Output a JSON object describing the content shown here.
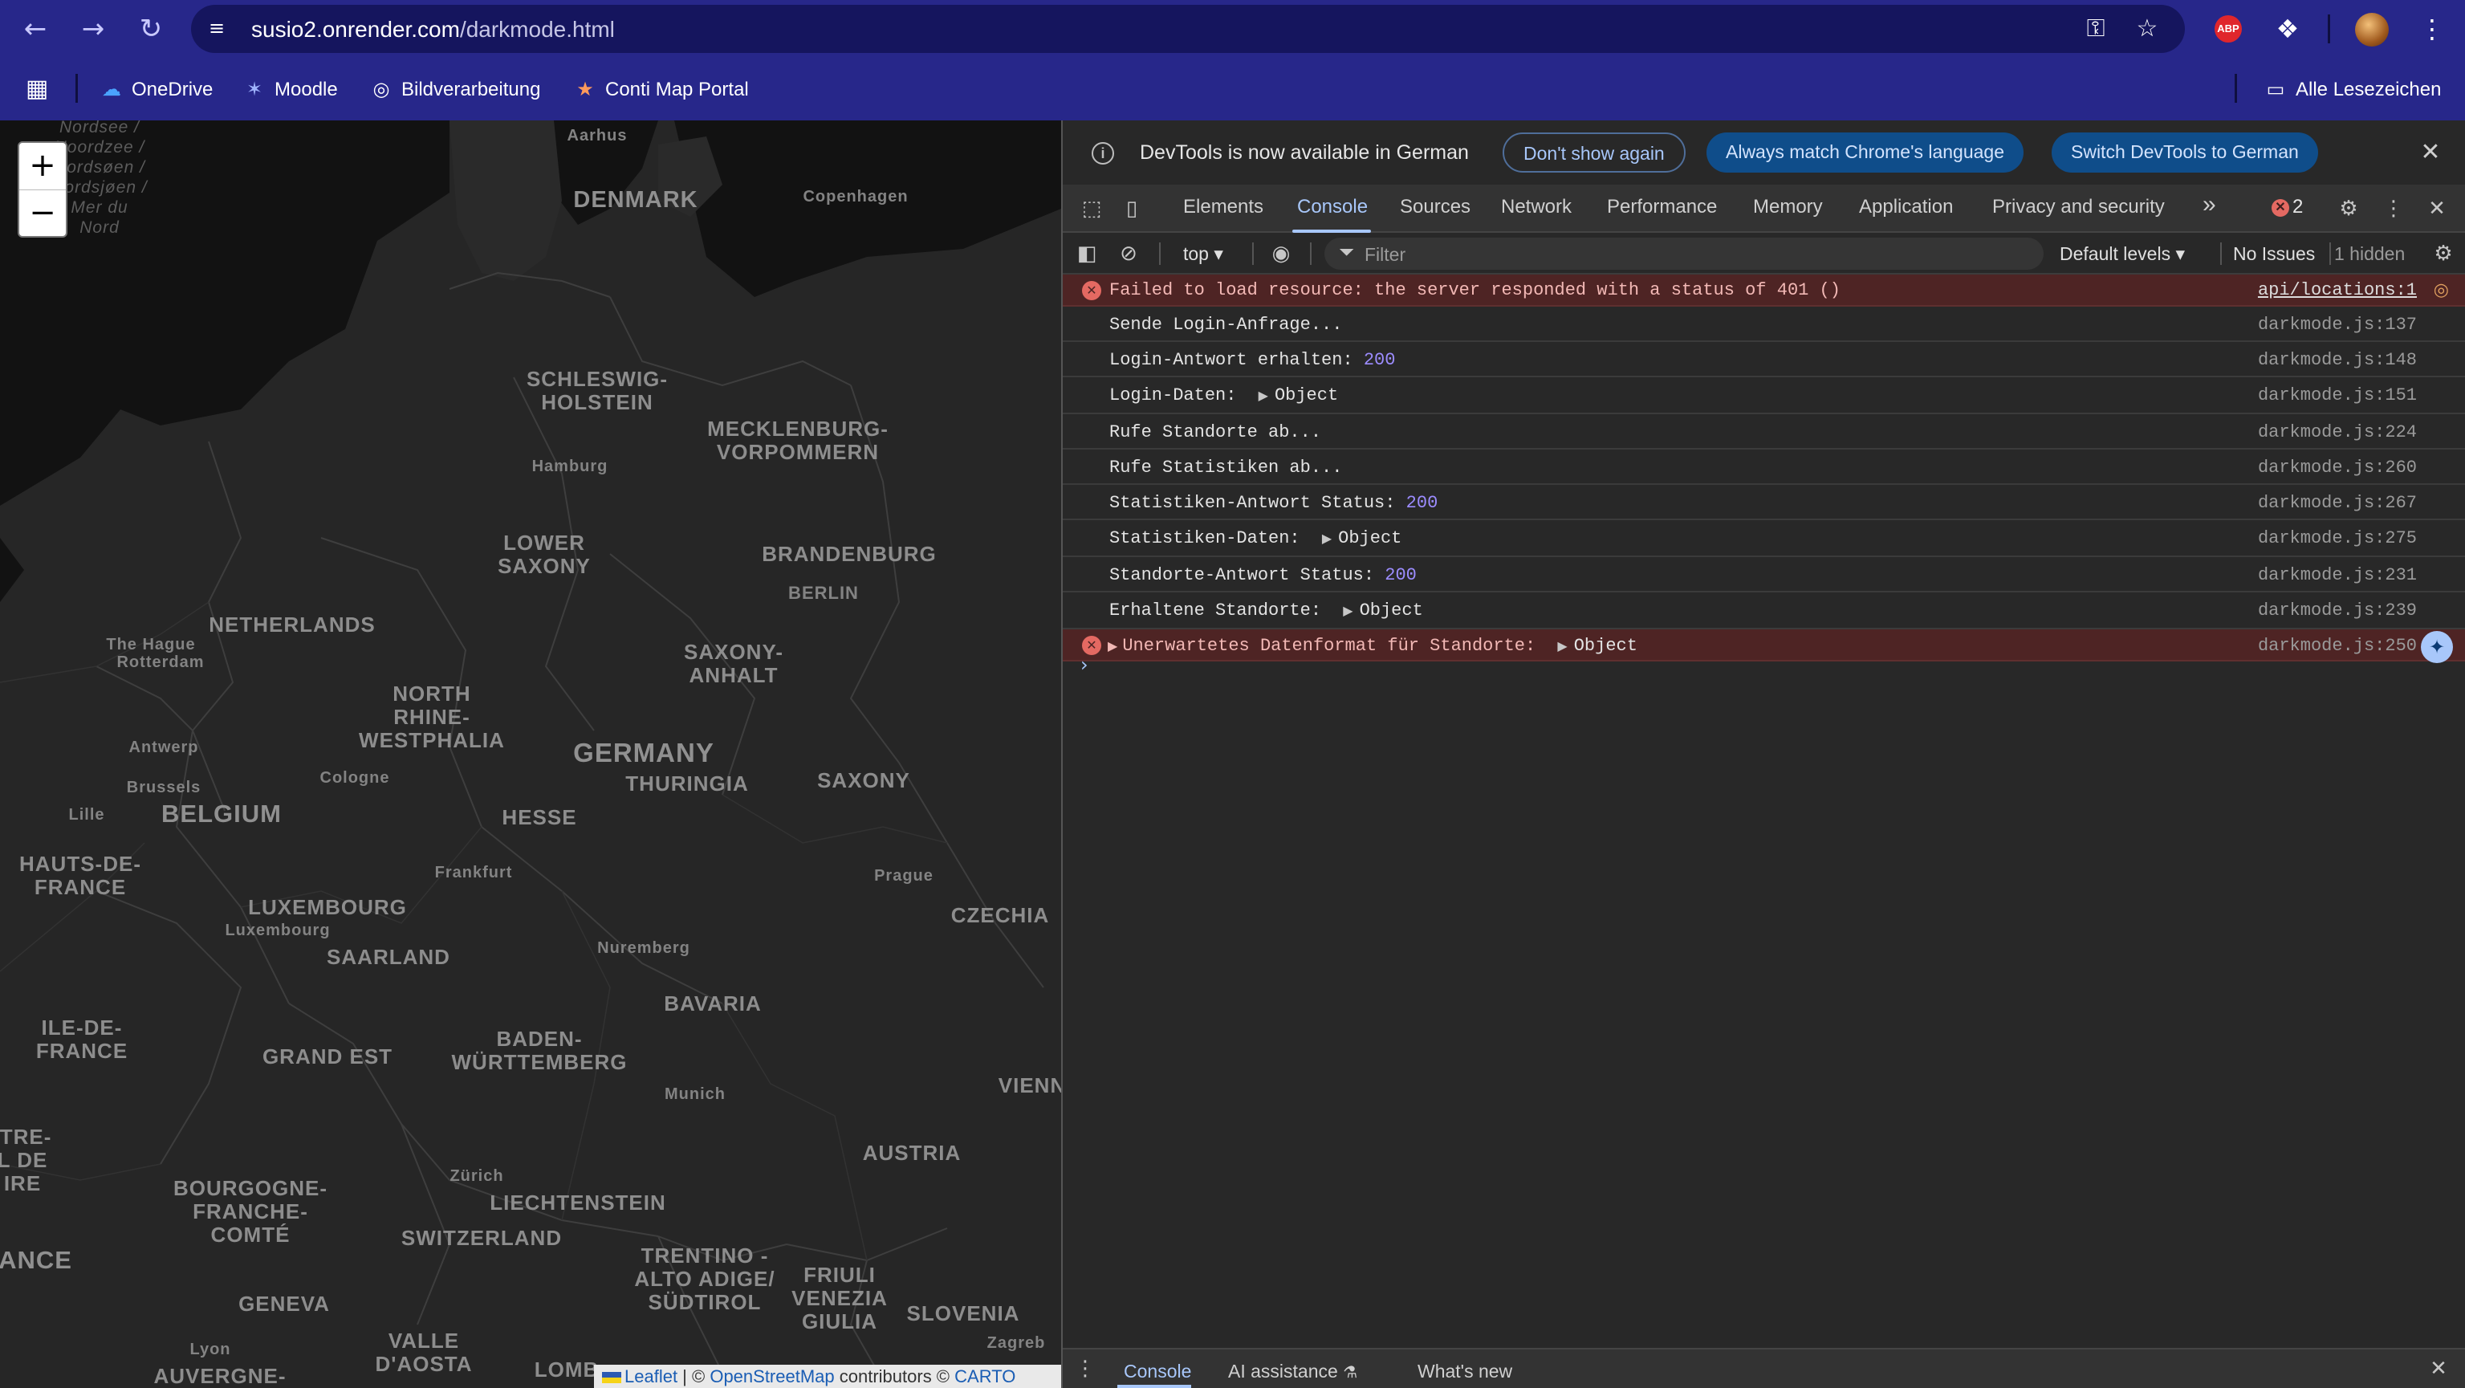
{
  "browser": {
    "back_icon": "arrow-left-icon",
    "forward_icon": "arrow-right-icon",
    "reload_icon": "reload-icon",
    "url_host": "susio2.onrender.com",
    "url_path": "/darkmode.html"
  },
  "bookmarks": {
    "items": [
      {
        "label": "OneDrive",
        "icon": "onedrive-icon"
      },
      {
        "label": "Moodle",
        "icon": "moodle-icon"
      },
      {
        "label": "Bildverarbeitung",
        "icon": "globe-icon"
      },
      {
        "label": "Conti Map Portal",
        "icon": "conti-icon"
      }
    ],
    "all_bookmarks": "Alle Lesezeichen"
  },
  "map": {
    "zoom_in": "+",
    "zoom_out": "−",
    "sea_label": [
      "Nordsee /",
      "Noordzee /",
      "Nordsøen /",
      "Nordsjøen /",
      "Mer du",
      "Nord"
    ],
    "labels": {
      "denmark": "DENMARK",
      "germany": "GERMANY",
      "belgium": "BELGIUM",
      "netherlands": "NETHERLANDS",
      "schleswig": [
        "SCHLESWIG-",
        "HOLSTEIN"
      ],
      "mecklenburg": [
        "MECKLENBURG-",
        "VORPOMMERN"
      ],
      "lower_saxony": [
        "LOWER",
        "SAXONY"
      ],
      "brandenburg": "BRANDENBURG",
      "saxony_anhalt": [
        "SAXONY-",
        "ANHALT"
      ],
      "nrw": [
        "NORTH",
        "RHINE-",
        "WESTPHALIA"
      ],
      "thuringia": "THURINGIA",
      "saxony": "SAXONY",
      "hesse": "HESSE",
      "luxembourg": "LUXEMBOURG",
      "saarland": "SAARLAND",
      "bavaria": "BAVARIA",
      "bw": [
        "BADEN-",
        "WÜRTTEMBERG"
      ],
      "czechia": "CZECHIA",
      "austria": "AUSTRIA",
      "switzerland": "SWITZERLAND",
      "liechtenstein": "LIECHTENSTEIN",
      "grand_est": "GRAND EST",
      "hauts": [
        "HAUTS-DE-",
        "FRANCE"
      ],
      "ile": [
        "ILE-DE-",
        "FRANCE"
      ],
      "bourgogne": [
        "BOURGOGNE-",
        "FRANCHE-",
        "COMTÉ"
      ],
      "trentino": [
        "TRENTINO -",
        "ALTO ADIGE/",
        "SÜDTIROL"
      ],
      "friuli": [
        "FRIULI",
        "VENEZIA",
        "GIULIA"
      ],
      "slovenia": "SLOVENIA",
      "valle": [
        "VALLE",
        "D'AOSTA"
      ],
      "geneva": "GENEVA",
      "france_partial": "ANCE",
      "centre": [
        "ITRE-",
        "L DE",
        "IRE"
      ],
      "auvergne": "AUVERGNE-",
      "lomb": "LOMB",
      "vienna": "VIENN"
    },
    "cities": {
      "aarhus": "Aarhus",
      "copenhagen": "Copenhagen",
      "hamburg": "Hamburg",
      "berlin": "BERLIN",
      "the_hague": "The Hague",
      "rotterdam": "Rotterdam",
      "antwerp": "Antwerp",
      "brussels": "Brussels",
      "lille": "Lille",
      "cologne": "Cologne",
      "frankfurt": "Frankfurt",
      "prague": "Prague",
      "luxembourg_city": "Luxembourg",
      "nuremberg": "Nuremberg",
      "munich": "Munich",
      "zurich": "Zürich",
      "lyon": "Lyon",
      "zagreb": "Zagreb"
    },
    "attribution": {
      "leaflet": "Leaflet",
      "sep": " | © ",
      "osm": "OpenStreetMap",
      "contrib": " contributors © ",
      "carto": "CARTO"
    }
  },
  "devtools": {
    "banner": {
      "text": "DevTools is now available in German",
      "dont_show": "Don't show again",
      "always_match": "Always match Chrome's language",
      "switch": "Switch DevTools to German"
    },
    "tabs": [
      "Elements",
      "Console",
      "Sources",
      "Network",
      "Performance",
      "Memory",
      "Application",
      "Privacy and security"
    ],
    "more_tabs": "»",
    "error_count": "2",
    "filter": {
      "context": "top",
      "placeholder": "Filter",
      "levels": "Default levels",
      "issues": "No Issues",
      "hidden": "1 hidden"
    },
    "console_rows": [
      {
        "msg": "Failed to load resource: the server responded with a status of 401 ()",
        "src": "api/locations:1",
        "level": "error"
      },
      {
        "msg": "Sende Login-Anfrage...",
        "src": "darkmode.js:137"
      },
      {
        "msg": "Login-Antwort erhalten: ",
        "num": "200",
        "src": "darkmode.js:148"
      },
      {
        "msg": "Login-Daten: ",
        "obj": "Object",
        "src": "darkmode.js:151"
      },
      {
        "msg": "Rufe Standorte ab...",
        "src": "darkmode.js:224"
      },
      {
        "msg": "Rufe Statistiken ab...",
        "src": "darkmode.js:260"
      },
      {
        "msg": "Statistiken-Antwort Status: ",
        "num": "200",
        "src": "darkmode.js:267"
      },
      {
        "msg": "Statistiken-Daten: ",
        "obj": "Object",
        "src": "darkmode.js:275"
      },
      {
        "msg": "Standorte-Antwort Status: ",
        "num": "200",
        "src": "darkmode.js:231"
      },
      {
        "msg": "Erhaltene Standorte: ",
        "obj": "Object",
        "src": "darkmode.js:239"
      },
      {
        "msg": "Unerwartetes Datenformat für Standorte: ",
        "obj": "Object",
        "src": "darkmode.js:250",
        "level": "error"
      }
    ],
    "drawer": {
      "console": "Console",
      "ai": "AI assistance",
      "whats_new": "What's new"
    }
  }
}
